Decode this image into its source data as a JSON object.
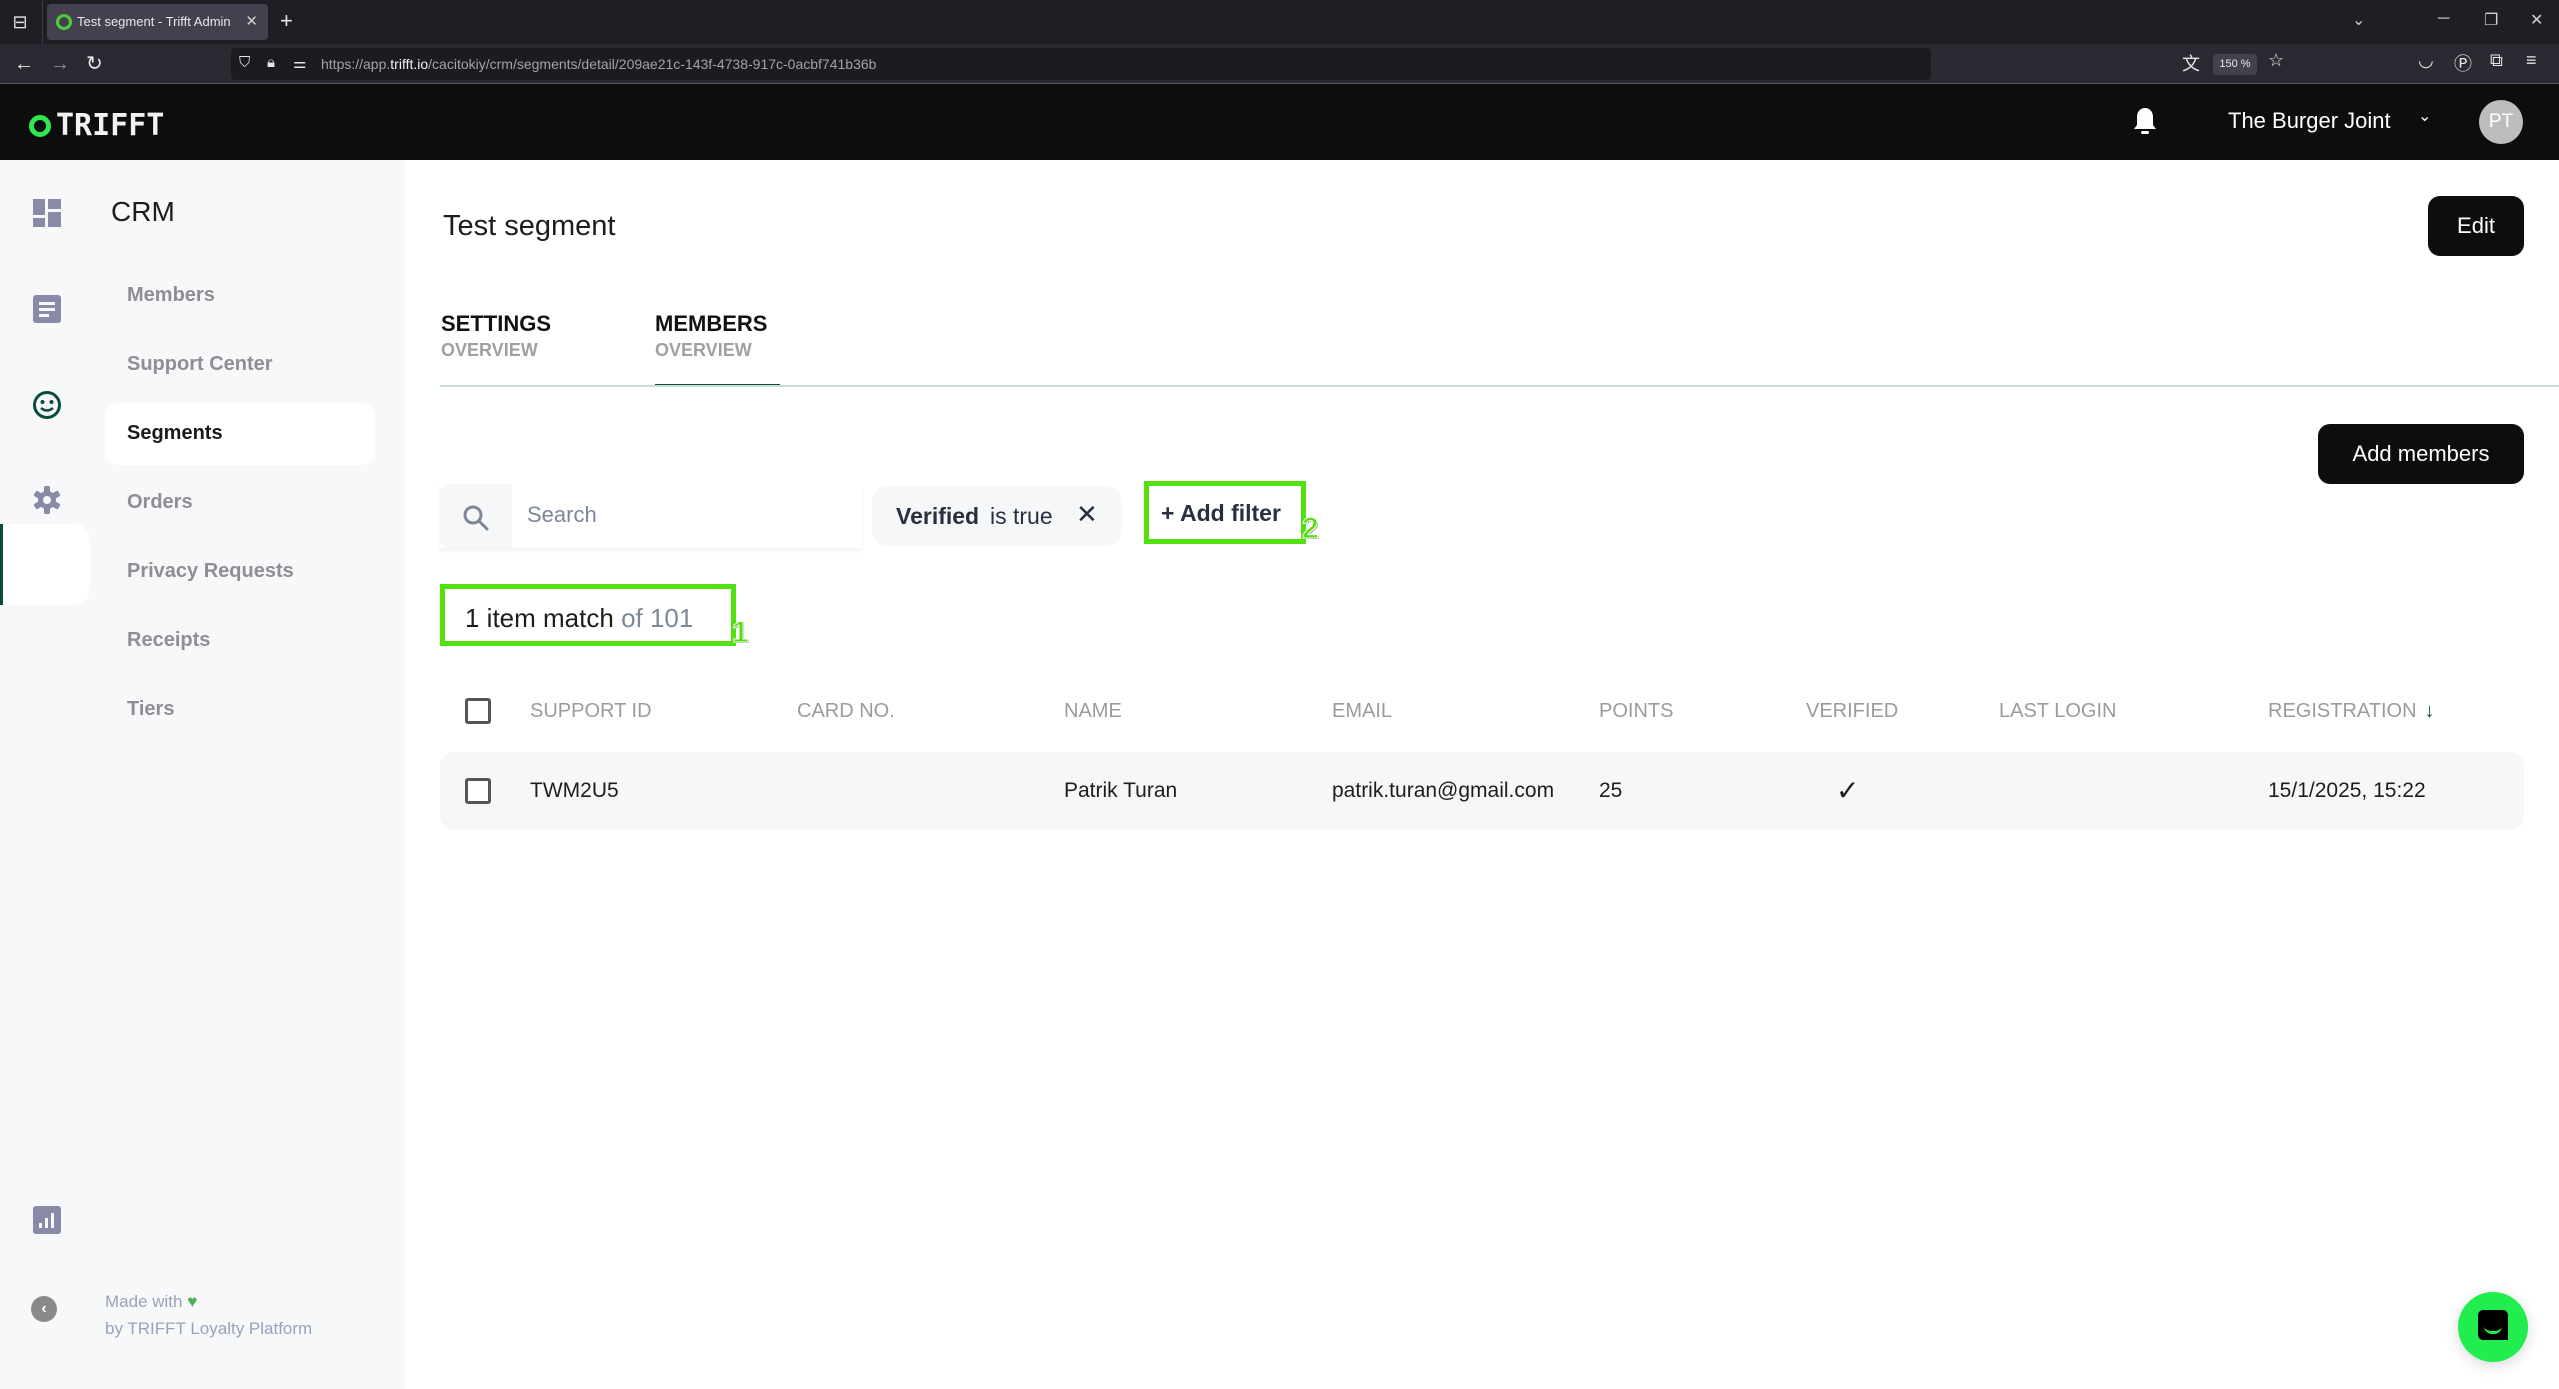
{
  "browser": {
    "tab_title": "Test segment - Trifft Admin",
    "url_prefix": "https://app.",
    "url_domain": "trifft.io",
    "url_path": "/cacitokiy/crm/segments/detail/209ae21c-143f-4738-917c-0acbf741b36b",
    "zoom_level": "150 %"
  },
  "header": {
    "logo_text": "TRIFFT",
    "org_name": "The Burger Joint",
    "avatar_initials": "PT"
  },
  "sidebar": {
    "section_title": "CRM",
    "items": [
      {
        "label": "Members",
        "active": false
      },
      {
        "label": "Support Center",
        "active": false
      },
      {
        "label": "Segments",
        "active": true
      },
      {
        "label": "Orders",
        "active": false
      },
      {
        "label": "Privacy Requests",
        "active": false
      },
      {
        "label": "Receipts",
        "active": false
      },
      {
        "label": "Tiers",
        "active": false
      }
    ],
    "footer_line1": "Made with",
    "footer_line2": "by TRIFFT Loyalty Platform"
  },
  "page": {
    "title": "Test segment",
    "edit_label": "Edit",
    "tabs": [
      {
        "title": "SETTINGS",
        "subtitle": "OVERVIEW",
        "active": false
      },
      {
        "title": "MEMBERS",
        "subtitle": "OVERVIEW",
        "active": true
      }
    ],
    "add_members_label": "Add members",
    "search_placeholder": "Search",
    "search_value": "",
    "filter": {
      "field": "Verified",
      "condition": "is true"
    },
    "add_filter_label": "+ Add filter",
    "match_count": "1 item match",
    "match_total": "of 101",
    "annotations": [
      "1",
      "2"
    ]
  },
  "table": {
    "columns": [
      "SUPPORT ID",
      "CARD NO.",
      "NAME",
      "EMAIL",
      "POINTS",
      "VERIFIED",
      "LAST LOGIN",
      "REGISTRATION"
    ],
    "sort_column": "REGISTRATION",
    "sort_direction": "desc",
    "rows": [
      {
        "support_id": "TWM2U5",
        "card_no": "",
        "name": "Patrik Turan",
        "email": "patrik.turan@gmail.com",
        "points": "25",
        "verified": true,
        "verified_glyph": "✓",
        "last_login": "",
        "registration": "15/1/2025, 15:22"
      }
    ]
  },
  "colors": {
    "accent_dark_green": "#0b4d3a",
    "brand_green": "#2ee84d",
    "annotation_green": "#52e10e",
    "button_black": "#0d0d0d"
  }
}
